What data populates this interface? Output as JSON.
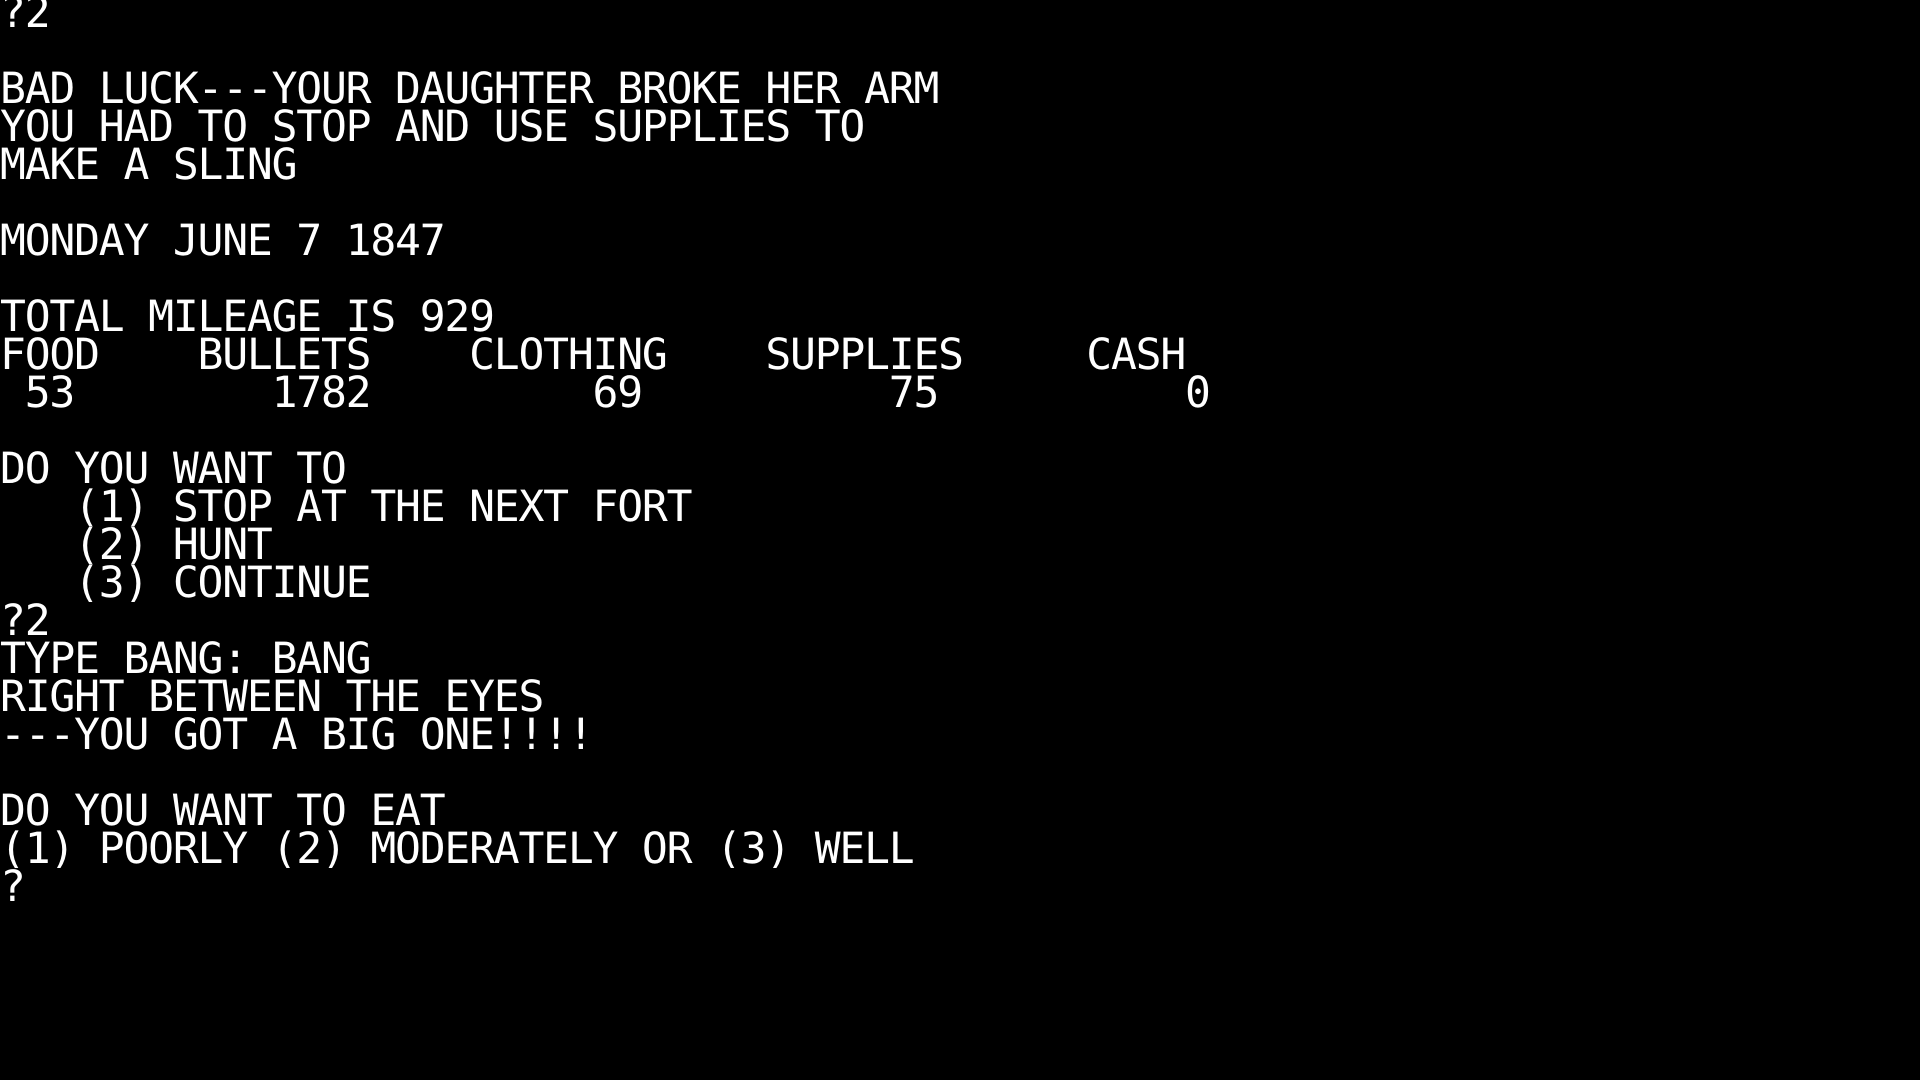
{
  "screen": {
    "title": "THE OREGON TRAIL",
    "background_color": "#000000",
    "text_color": "#ffffff",
    "columns": 59,
    "rows": 28
  },
  "terminal": {
    "lines": [
      {
        "id": "echo-choice-1",
        "text": "?2",
        "kind": "input-echo"
      },
      {
        "id": "spacer-1",
        "text": "",
        "kind": "blank"
      },
      {
        "id": "event-line-1",
        "text": "BAD LUCK---YOUR DAUGHTER BROKE HER ARM",
        "kind": "event"
      },
      {
        "id": "event-line-2",
        "text": "YOU HAD TO STOP AND USE SUPPLIES TO",
        "kind": "event"
      },
      {
        "id": "event-line-3",
        "text": "MAKE A SLING",
        "kind": "event"
      },
      {
        "id": "spacer-2",
        "text": "",
        "kind": "blank"
      },
      {
        "id": "date-line",
        "text": "MONDAY JUNE 7 1847",
        "kind": "status"
      },
      {
        "id": "spacer-3",
        "text": "",
        "kind": "blank"
      },
      {
        "id": "mileage-line",
        "text": "TOTAL MILEAGE IS 929",
        "kind": "status"
      },
      {
        "id": "stats-header",
        "text": "FOOD    BULLETS    CLOTHING    SUPPLIES     CASH",
        "kind": "stats-header"
      },
      {
        "id": "stats-values",
        "text": " 53        1782         69          75          0",
        "kind": "stats-values"
      },
      {
        "id": "spacer-4",
        "text": "",
        "kind": "blank"
      },
      {
        "id": "prompt-travel",
        "text": "DO YOU WANT TO",
        "kind": "prompt"
      },
      {
        "id": "option-travel-1",
        "text": "   (1) STOP AT THE NEXT FORT",
        "kind": "option"
      },
      {
        "id": "option-travel-2",
        "text": "   (2) HUNT",
        "kind": "option"
      },
      {
        "id": "option-travel-3",
        "text": "   (3) CONTINUE",
        "kind": "option"
      },
      {
        "id": "echo-choice-2",
        "text": "?2",
        "kind": "input-echo"
      },
      {
        "id": "hunt-line-1",
        "text": "TYPE BANG: BANG",
        "kind": "hunt"
      },
      {
        "id": "hunt-line-2",
        "text": "RIGHT BETWEEN THE EYES",
        "kind": "hunt"
      },
      {
        "id": "hunt-line-3",
        "text": "---YOU GOT A BIG ONE!!!!",
        "kind": "hunt"
      },
      {
        "id": "spacer-5",
        "text": "",
        "kind": "blank"
      },
      {
        "id": "prompt-eat",
        "text": "DO YOU WANT TO EAT",
        "kind": "prompt"
      },
      {
        "id": "options-eat",
        "text": "(1) POORLY (2) MODERATELY OR (3) WELL",
        "kind": "option"
      },
      {
        "id": "cursor-prompt",
        "text": "?",
        "kind": "input-prompt"
      }
    ]
  },
  "game_state": {
    "date": "MONDAY JUNE 7 1847",
    "total_mileage": 929,
    "stat_labels": [
      "FOOD",
      "BULLETS",
      "CLOTHING",
      "SUPPLIES",
      "CASH"
    ],
    "stat_values": [
      "53",
      "1782",
      "69",
      "75",
      "0"
    ],
    "event_message": "BAD LUCK---YOUR DAUGHTER BROKE HER ARM YOU HAD TO STOP AND USE SUPPLIES TO MAKE A SLING",
    "travel_menu": {
      "prompt": "DO YOU WANT TO",
      "options": [
        {
          "key": "1",
          "label": "STOP AT THE NEXT FORT"
        },
        {
          "key": "2",
          "label": "HUNT"
        },
        {
          "key": "3",
          "label": "CONTINUE"
        }
      ],
      "chosen": "2"
    },
    "hunt_result": {
      "type_prompt": "TYPE BANG: ",
      "typed": "BANG",
      "accuracy": "RIGHT BETWEEN THE EYES",
      "outcome": "---YOU GOT A BIG ONE!!!!"
    },
    "eat_menu": {
      "prompt": "DO YOU WANT TO EAT",
      "options_line": "(1) POORLY (2) MODERATELY OR (3) WELL",
      "options": [
        {
          "key": "1",
          "label": "POORLY"
        },
        {
          "key": "2",
          "label": "MODERATELY"
        },
        {
          "key": "3",
          "label": "WELL"
        }
      ],
      "cursor": "?"
    }
  }
}
